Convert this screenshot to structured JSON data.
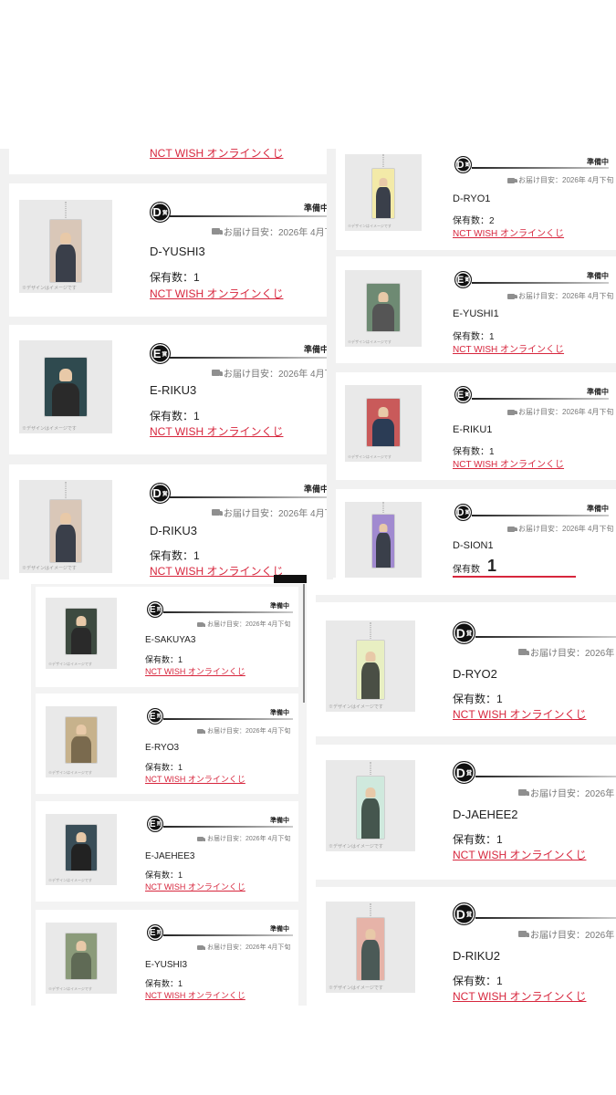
{
  "common": {
    "status": "準備中",
    "eta": "お届け目安：2026年 4月下旬",
    "qty_label": "保有数：1",
    "qty_label_2": "保有数：2",
    "qty_label_cut": "保有数",
    "qty_overlay": "1",
    "link": "NCT WISH オンラインくじ",
    "image_note": "※デザインはイメージです",
    "prize_suffix": "賞",
    "truck_icon": "truck-icon"
  },
  "cards": [
    {
      "prize": "D",
      "title": "D-YUSHI3"
    },
    {
      "prize": "E",
      "title": "E-RIKU3"
    },
    {
      "prize": "D",
      "title": "D-RIKU3"
    },
    {
      "prize": "D",
      "title": "D-RYO1"
    },
    {
      "prize": "E",
      "title": "E-YUSHI1"
    },
    {
      "prize": "E",
      "title": "E-RIKU1"
    },
    {
      "prize": "D",
      "title": "D-SION1"
    },
    {
      "prize": "E",
      "title": "E-SAKUYA3"
    },
    {
      "prize": "E",
      "title": "E-RYO3"
    },
    {
      "prize": "E",
      "title": "E-JAEHEE3"
    },
    {
      "prize": "E",
      "title": "E-YUSHI3"
    },
    {
      "prize": "D",
      "title": "D-RYO2"
    },
    {
      "prize": "D",
      "title": "D-JAEHEE2"
    },
    {
      "prize": "D",
      "title": "D-RIKU2"
    }
  ],
  "colors": {
    "link": "#d7263d",
    "badge": "#111111",
    "panel": "#f1f1f1"
  }
}
